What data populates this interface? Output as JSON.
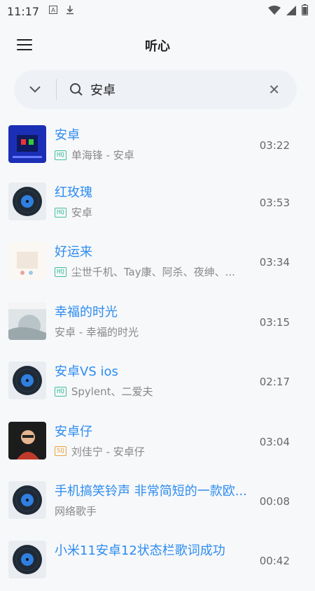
{
  "status_bar": {
    "time": "11:17",
    "icons": [
      "a-icon",
      "download-icon",
      "wifi-icon",
      "signal-icon",
      "battery-icon"
    ]
  },
  "app_bar": {
    "title": "听心",
    "menu_icon": "hamburger-icon"
  },
  "search": {
    "value": "安卓",
    "dropdown_icon": "chevron-down-icon",
    "search_icon": "search-icon",
    "clear_icon": "close-icon"
  },
  "songs": [
    {
      "title": "安卓",
      "badge": "HQ",
      "meta": "单海锋 - 安卓",
      "duration": "03:22",
      "cover": "art-blue"
    },
    {
      "title": "红玫瑰",
      "badge": "HQ",
      "meta": "安卓",
      "duration": "03:53",
      "cover": "vinyl"
    },
    {
      "title": "好运来",
      "badge": "HQ",
      "meta": "尘世千机、Tay康、阿杀、夜绅、...",
      "duration": "03:34",
      "cover": "art-light"
    },
    {
      "title": "幸福的时光",
      "badge": "",
      "meta": "安卓 - 幸福的时光",
      "duration": "03:15",
      "cover": "art-photo"
    },
    {
      "title": "安卓VS ios",
      "badge": "HQ",
      "meta": "Spylent、二爱夫",
      "duration": "02:17",
      "cover": "vinyl"
    },
    {
      "title": "安卓仔",
      "badge": "SQ",
      "meta": "刘佳宁 - 安卓仔",
      "duration": "03:04",
      "cover": "art-dark"
    },
    {
      "title": "手机搞笑铃声 非常简短的一款欧...",
      "badge": "",
      "meta": "网络歌手",
      "duration": "00:08",
      "cover": "vinyl"
    },
    {
      "title": "小米11安卓12状态栏歌词成功",
      "badge": "",
      "meta": "",
      "duration": "00:42",
      "cover": "vinyl"
    }
  ]
}
